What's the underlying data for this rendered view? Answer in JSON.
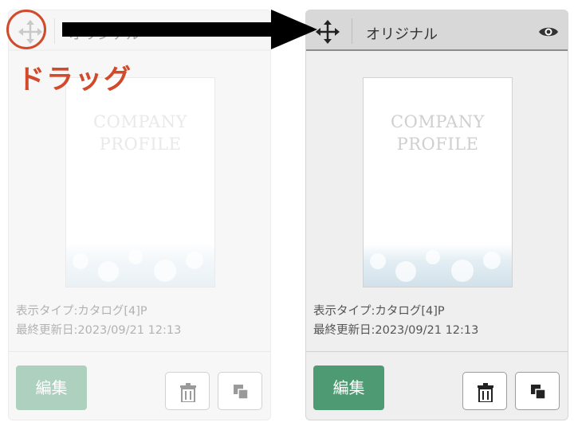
{
  "annotation": {
    "drag_label": "ドラッグ",
    "accent_color": "#d14a2b"
  },
  "cards": [
    {
      "state": "faded",
      "title": "オリジナル",
      "thumbnail": {
        "line1": "COMPANY",
        "line2": "PROFILE"
      },
      "display_type": "表示タイプ:カタログ[4]P",
      "last_updated": "最終更新日:2023/09/21 12:13",
      "edit_label": "編集"
    },
    {
      "state": "normal",
      "title": "オリジナル",
      "thumbnail": {
        "line1": "COMPANY",
        "line2": "PROFILE"
      },
      "display_type": "表示タイプ:カタログ[4]P",
      "last_updated": "最終更新日:2023/09/21 12:13",
      "edit_label": "編集"
    }
  ],
  "icons": [
    "move-icon",
    "eye-icon",
    "trash-icon",
    "copy-icon",
    "arrow-right-icon"
  ],
  "colors": {
    "edit_button": "#4e9a72",
    "header_bg": "#d8d8d8",
    "card_bg": "#efefef"
  }
}
